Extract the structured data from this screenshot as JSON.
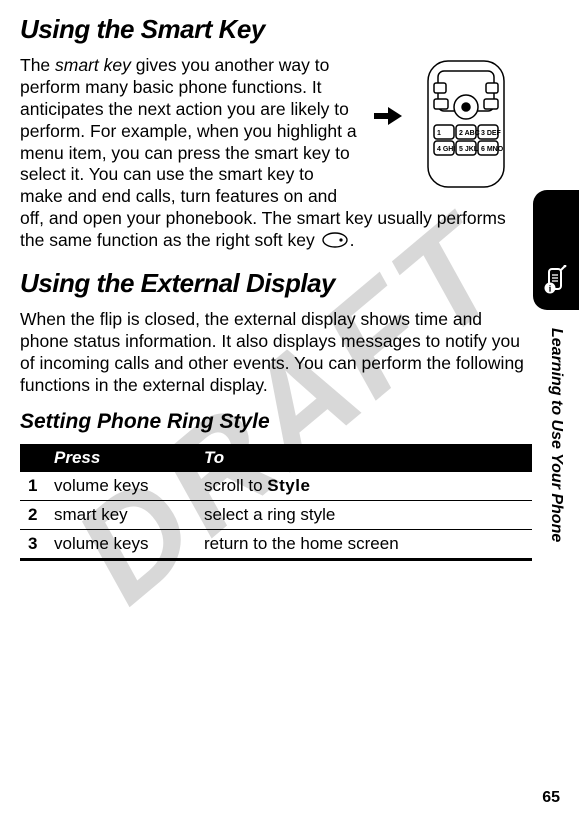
{
  "watermark": "DRAFT",
  "headings": {
    "using_smart_key": "Using the Smart Key",
    "using_external_display": "Using the External Display",
    "setting_ring_style": "Setting Phone Ring Style"
  },
  "body": {
    "smart_key_lead_italic": "smart key",
    "smart_key_pre": "The ",
    "smart_key_post": " gives you another way to perform many basic phone functions. It anticipates the next action you are likely to perform. For example, when you highlight a menu item, you can press the smart key to select it. You can use the smart key to make and end calls, turn features on and off, and open your phonebook. The smart key usually performs the same function as the right soft key ",
    "smart_key_tail": ".",
    "external_display": "When the flip is closed, the external display shows time and phone status information. It also displays messages to notify you of incoming calls and other events. You can perform the following functions in the external display."
  },
  "table": {
    "headers": {
      "step": "",
      "press": "Press",
      "to": "To"
    },
    "rows": [
      {
        "step": "1",
        "press": "volume keys",
        "to_pre": "scroll to ",
        "to_bold": "Style"
      },
      {
        "step": "2",
        "press": "smart key",
        "to_pre": "select a ring style",
        "to_bold": ""
      },
      {
        "step": "3",
        "press": "volume keys",
        "to_pre": "return to the home screen",
        "to_bold": ""
      }
    ]
  },
  "rail": {
    "section_label": "Learning to Use Your Phone"
  },
  "page_number": "65"
}
